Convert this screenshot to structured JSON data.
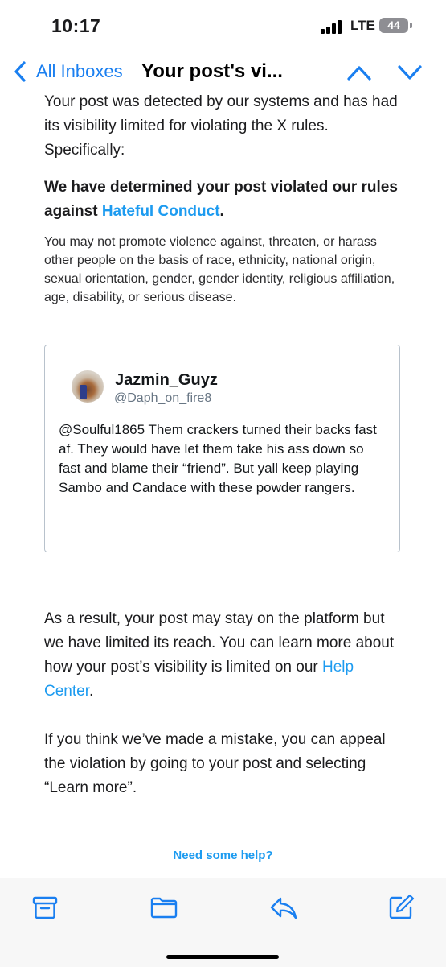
{
  "status_bar": {
    "time": "10:17",
    "network": "LTE",
    "battery": "44"
  },
  "nav": {
    "back_label": "All Inboxes",
    "title": "Your post's vi..."
  },
  "email": {
    "intro": "Your post was detected by our systems and has had its visibility limited for violating the X rules. Specifically:",
    "determined_prefix": "We have determined your post violated our rules against ",
    "determined_link": "Hateful Conduct",
    "determined_suffix": ".",
    "policy": "You may not promote violence against, threaten, or harass other people on the basis of race, ethnicity, national origin, sexual orientation, gender, gender identity, religious affiliation, age, disability, or serious disease.",
    "tweet": {
      "name": "Jazmin_Guyz",
      "handle": "@Daph_on_fire8",
      "text": "@Soulful1865 Them crackers turned their backs fast af. They would have let them take his ass down so fast and blame their “friend”. But yall keep playing Sambo and Candace with these powder rangers."
    },
    "result_prefix": "As a result, your post may stay on the platform but we have limited its reach. You can learn more about how your post’s visibility is limited on our ",
    "result_link": "Help Center",
    "result_suffix": ".",
    "appeal": "If you think we’ve made a mistake, you can appeal the violation by going to your post and selecting “Learn more”.",
    "help_link": "Need some help?"
  },
  "colors": {
    "ios_blue": "#1a7ff0",
    "x_link_blue": "#1d9bf0"
  },
  "toolbar": {
    "icons": [
      "archive-icon",
      "folder-icon",
      "reply-icon",
      "compose-icon"
    ]
  }
}
